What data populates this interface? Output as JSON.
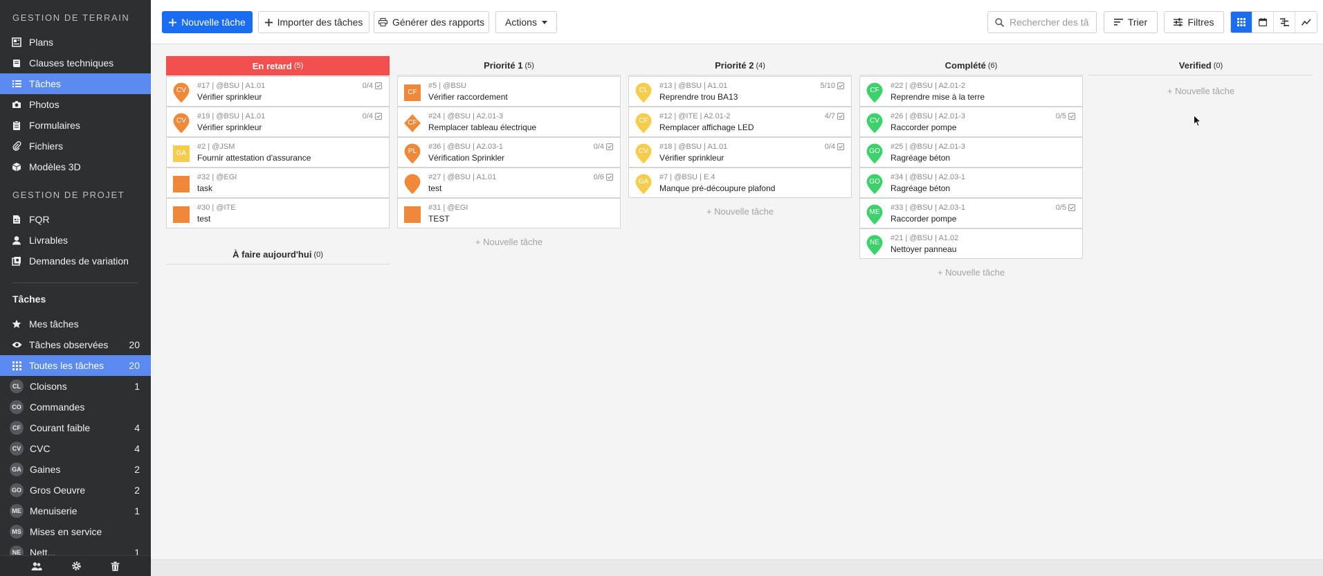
{
  "sidebar": {
    "section_field": "GESTION DE TERRAIN",
    "field_items": [
      {
        "label": "Plans",
        "icon": "plans-icon"
      },
      {
        "label": "Clauses techniques",
        "icon": "book-icon"
      },
      {
        "label": "Tâches",
        "icon": "list-icon",
        "active": true
      },
      {
        "label": "Photos",
        "icon": "camera-icon"
      },
      {
        "label": "Formulaires",
        "icon": "clipboard-icon"
      },
      {
        "label": "Fichiers",
        "icon": "paperclip-icon"
      },
      {
        "label": "Modèles 3D",
        "icon": "cube-icon"
      }
    ],
    "section_project": "GESTION DE PROJET",
    "project_items": [
      {
        "label": "FQR",
        "icon": "document-icon"
      },
      {
        "label": "Livrables",
        "icon": "user-icon"
      },
      {
        "label": "Demandes de variation",
        "icon": "copy-icon"
      }
    ],
    "tasks_heading": "Tâches",
    "task_filters": [
      {
        "label": "Mes tâches",
        "icon": "star-icon",
        "count": ""
      },
      {
        "label": "Tâches observées",
        "icon": "eye-icon",
        "count": "20"
      },
      {
        "label": "Toutes les tâches",
        "icon": "grid-icon",
        "count": "20",
        "active": true
      }
    ],
    "categories": [
      {
        "code": "CL",
        "label": "Cloisons",
        "count": "1"
      },
      {
        "code": "CO",
        "label": "Commandes",
        "count": ""
      },
      {
        "code": "CF",
        "label": "Courant faible",
        "count": "4"
      },
      {
        "code": "CV",
        "label": "CVC",
        "count": "4"
      },
      {
        "code": "GA",
        "label": "Gaines",
        "count": "2"
      },
      {
        "code": "GO",
        "label": "Gros Oeuvre",
        "count": "2"
      },
      {
        "code": "ME",
        "label": "Menuiserie",
        "count": "1"
      },
      {
        "code": "MS",
        "label": "Mises en service",
        "count": ""
      },
      {
        "code": "NE",
        "label": "Nett...",
        "count": "1"
      }
    ]
  },
  "toolbar": {
    "new_task": "Nouvelle tâche",
    "import_tasks": "Importer des tâches",
    "generate_reports": "Générer des rapports",
    "actions": "Actions",
    "search_placeholder": "Rechercher des tâ",
    "sort": "Trier",
    "filters": "Filtres"
  },
  "colors": {
    "accent": "#1a6cf0",
    "late": "#f24f4f",
    "orange": "#f0883a",
    "yellow": "#f5cc4c",
    "green": "#3dd16b"
  },
  "columns": [
    {
      "title": "En retard",
      "count": "(5)",
      "add": ""
    },
    {
      "title": "Priorité 1",
      "count": "(5)",
      "add": "+ Nouvelle tâche"
    },
    {
      "title": "Priorité 2",
      "count": "(4)",
      "add": "+ Nouvelle tâche"
    },
    {
      "title": "Complété",
      "count": "(6)",
      "add": "+ Nouvelle tâche"
    },
    {
      "title": "Verified",
      "count": "(0)",
      "add": "+ Nouvelle tâche"
    }
  ],
  "today_column": {
    "title": "À faire aujourd'hui",
    "count": "(0)"
  },
  "cards": [
    [
      {
        "meta": "#17 | @BSU | A1.01",
        "title": "Vérifier sprinkleur",
        "check": "0/4",
        "code": "CV",
        "shape": "pin",
        "color": "orange"
      },
      {
        "meta": "#19 | @BSU | A1.01",
        "title": "Vérifier sprinkleur",
        "check": "0/4",
        "code": "CV",
        "shape": "pin",
        "color": "orange"
      },
      {
        "meta": "#2 | @JSM",
        "title": "Fournir attestation d'assurance",
        "check": "",
        "code": "GA",
        "shape": "square",
        "color": "yellow"
      },
      {
        "meta": "#32 | @EGI",
        "title": "task",
        "check": "",
        "code": "",
        "shape": "square",
        "color": "orange"
      },
      {
        "meta": "#30 | @ITE",
        "title": "test",
        "check": "",
        "code": "",
        "shape": "square",
        "color": "orange"
      }
    ],
    [
      {
        "meta": "#5 | @BSU",
        "title": "Vérifier raccordement",
        "check": "",
        "code": "CF",
        "shape": "square",
        "color": "orange"
      },
      {
        "meta": "#24 | @BSU | A2.01-3",
        "title": "Remplacer tableau électrique",
        "check": "",
        "code": "CF",
        "shape": "diamond",
        "color": "orange"
      },
      {
        "meta": "#36 | @BSU | A2.03-1",
        "title": "Vérification Sprinkler",
        "check": "0/4",
        "code": "PL",
        "shape": "pin",
        "color": "orange"
      },
      {
        "meta": "#27 | @BSU | A1.01",
        "title": "test",
        "check": "0/6",
        "code": "",
        "shape": "pin",
        "color": "orange"
      },
      {
        "meta": "#31 | @EGI",
        "title": "TEST",
        "check": "",
        "code": "",
        "shape": "square",
        "color": "orange"
      }
    ],
    [
      {
        "meta": "#13 | @BSU | A1.01",
        "title": "Reprendre trou BA13",
        "check": "5/10",
        "code": "CL",
        "shape": "pin",
        "color": "yellow"
      },
      {
        "meta": "#12 | @ITE | A2.01-2",
        "title": "Remplacer affichage LED",
        "check": "4/7",
        "code": "CF",
        "shape": "pin",
        "color": "yellow"
      },
      {
        "meta": "#18 | @BSU | A1.01",
        "title": "Vérifier sprinkleur",
        "check": "0/4",
        "code": "CV",
        "shape": "pin",
        "color": "yellow"
      },
      {
        "meta": "#7 | @BSU | E.4",
        "title": "Manque pré-découpure plafond",
        "check": "",
        "code": "GA",
        "shape": "pin",
        "color": "yellow"
      }
    ],
    [
      {
        "meta": "#22 | @BSU | A2.01-2",
        "title": "Reprendre mise à la terre",
        "check": "",
        "code": "CF",
        "shape": "pin",
        "color": "green"
      },
      {
        "meta": "#26 | @BSU | A2.01-3",
        "title": "Raccorder pompe",
        "check": "0/5",
        "code": "CV",
        "shape": "pin",
        "color": "green"
      },
      {
        "meta": "#25 | @BSU | A2.01-3",
        "title": "Ragréage béton",
        "check": "",
        "code": "GO",
        "shape": "pin",
        "color": "green"
      },
      {
        "meta": "#34 | @BSU | A2.03-1",
        "title": "Ragréage béton",
        "check": "",
        "code": "GO",
        "shape": "pin",
        "color": "green"
      },
      {
        "meta": "#33 | @BSU | A2.03-1",
        "title": "Raccorder pompe",
        "check": "0/5",
        "code": "ME",
        "shape": "pin",
        "color": "green"
      },
      {
        "meta": "#21 | @BSU | A1.02",
        "title": "Nettoyer panneau",
        "check": "",
        "code": "NE",
        "shape": "pin",
        "color": "green"
      }
    ],
    []
  ]
}
